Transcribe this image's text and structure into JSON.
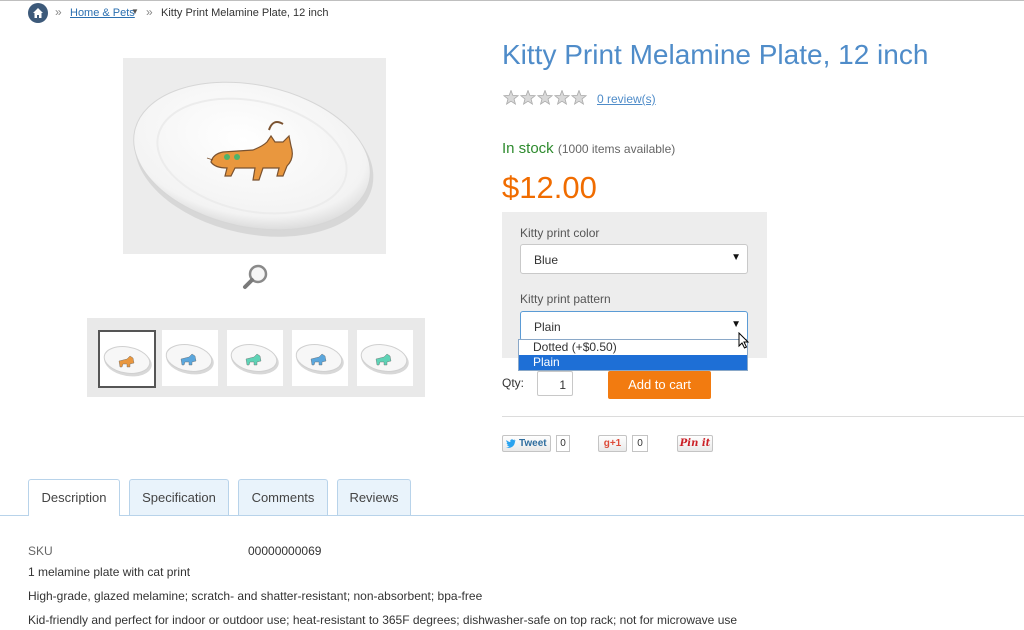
{
  "breadcrumb": {
    "separator": "»",
    "category": "Home & Pets",
    "current": "Kitty Print Melamine Plate, 12 inch"
  },
  "product": {
    "title": "Kitty Print Melamine Plate, 12 inch",
    "rating_stars": 0,
    "reviews_link": "0 review(s)",
    "stock_status": "In stock",
    "availability": "(1000 items available)",
    "price": "$12.00"
  },
  "options": {
    "color": {
      "label": "Kitty print color",
      "value": "Blue"
    },
    "pattern": {
      "label": "Kitty print pattern",
      "value": "Plain",
      "open_options": [
        "Dotted (+$0.50)",
        "Plain"
      ],
      "highlighted_index": 1
    }
  },
  "purchase": {
    "qty_label": "Qty:",
    "qty_value": "1",
    "add_to_cart": "Add to cart"
  },
  "social": {
    "tweet": {
      "label": "Tweet",
      "count": "0"
    },
    "gplus": {
      "label": "+1",
      "count": "0"
    },
    "pinterest": {
      "label": "Pin it"
    }
  },
  "gallery": {
    "thumb_colors": [
      "#e9973e",
      "#5ba7dd",
      "#5fd3b6",
      "#5ba7dd",
      "#5fd3b6"
    ],
    "active_thumb": 0
  },
  "tabs": [
    {
      "label": "Description",
      "active": true
    },
    {
      "label": "Specification",
      "active": false
    },
    {
      "label": "Comments",
      "active": false
    },
    {
      "label": "Reviews",
      "active": false
    }
  ],
  "description": {
    "sku_label": "SKU",
    "sku_value": "00000000069",
    "lines": [
      "1 melamine plate with cat print",
      "High-grade, glazed melamine; scratch- and shatter-resistant; non-absorbent; bpa-free",
      "Kid-friendly and perfect for indoor or outdoor use; heat-resistant to 365F degrees; dishwasher-safe on top rack; not for microwave use"
    ]
  },
  "colors": {
    "title": "#4f8cc9",
    "price": "#f06c00",
    "stock": "#2e8b2e",
    "cart_button": "#f27b10",
    "highlight": "#1e6fd6"
  }
}
